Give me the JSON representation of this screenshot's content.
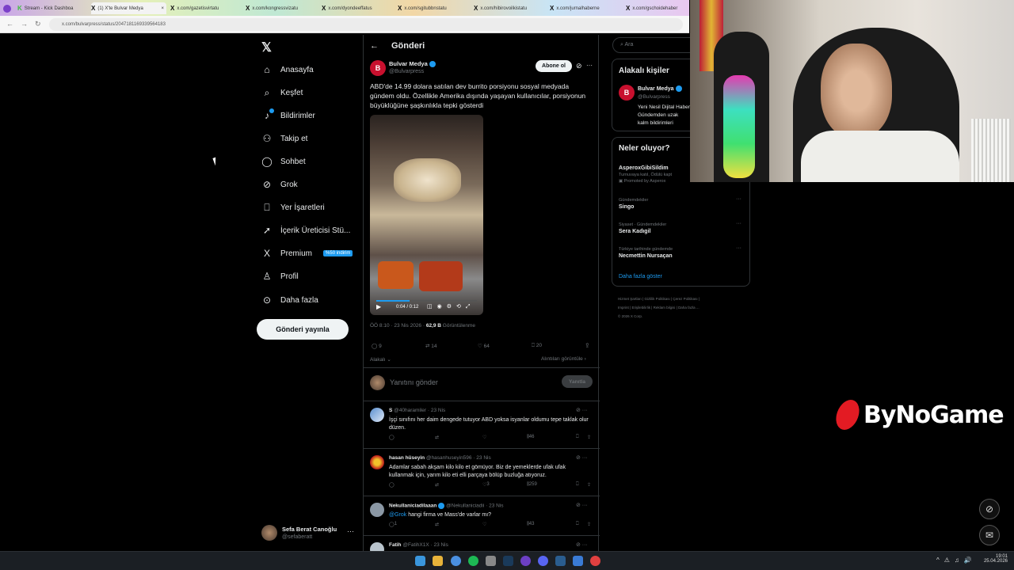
{
  "browser": {
    "tabs": [
      {
        "title": "Stream - Kick Dashboa",
        "icon": "kick-icon"
      },
      {
        "title": "(1) X'te Bulvar Medya",
        "icon": "x-icon",
        "active": true
      },
      {
        "title": "x.com/gazetisvirtatu",
        "icon": "x-icon"
      },
      {
        "title": "x.com/kongressvizatu",
        "icon": "x-icon"
      },
      {
        "title": "x.com/dyondeeffatus",
        "icon": "x-icon"
      },
      {
        "title": "x.com/sgitubbnstatu",
        "icon": "x-icon"
      },
      {
        "title": "x.com/hibirovoilkistatu",
        "icon": "x-icon"
      },
      {
        "title": "x.com/jurnalhaberne",
        "icon": "x-icon"
      },
      {
        "title": "x.com/gschoidehaber",
        "icon": "x-icon"
      }
    ],
    "url": "x.com/bulvarpress/status/2047181169339564183"
  },
  "nav": {
    "items": [
      {
        "label": "Anasayfa",
        "icon": "home-icon"
      },
      {
        "label": "Keşfet",
        "icon": "search-icon"
      },
      {
        "label": "Bildirimler",
        "icon": "bell-icon"
      },
      {
        "label": "Takip et",
        "icon": "follow-icon"
      },
      {
        "label": "Sohbet",
        "icon": "chat-icon"
      },
      {
        "label": "Grok",
        "icon": "grok-icon"
      },
      {
        "label": "Yer İşaretleri",
        "icon": "bookmark-icon"
      },
      {
        "label": "İçerik Üreticisi Stü...",
        "icon": "rocket-icon"
      },
      {
        "label": "Premium",
        "icon": "x-icon"
      },
      {
        "label": "Profil",
        "icon": "person-icon"
      },
      {
        "label": "Daha fazla",
        "icon": "more-circle-icon"
      }
    ],
    "premium_badge": "%50 indirim",
    "post_button": "Gönderi yayınla",
    "account_name": "Sefa Berat Canoğlu",
    "account_handle": "@sefaberatt"
  },
  "post": {
    "header_title": "Gönderi",
    "author_name": "Bulvar Medya",
    "author_handle": "@Bulvarpress",
    "follow_button": "Abone ol",
    "text": "ABD'de 14.99 dolara satılan dev burrito porsiyonu sosyal medyada gündem oldu. Özellikle Amerika dışında yaşayan kullanıcılar, porsiyonun büyüklüğüne şaşkınlıkla tepki gösterdi",
    "video_time": "0:04 / 0:12",
    "video_progress": 0.33,
    "timestamp": "ÖÖ 8:10 · 23 Nis 2026 ·",
    "views": "62,9 B",
    "views_label": "Görüntülenme",
    "replies": "9",
    "reposts": "14",
    "likes": "64",
    "bookmarks": "20",
    "relevant": "Alakalı",
    "quotes": "Alıntıları görüntüle",
    "reply_placeholder": "Yanıtını gönder",
    "reply_button": "Yanıtla"
  },
  "replies": [
    {
      "name": "S",
      "handle": "@40haramiler · 23 Nis",
      "text": "İşçi sınıfını her daim dengede tutuyor ABD yoksa isyanlar oldumu tepe taklak olur düzen.",
      "replies": "",
      "reposts": "",
      "likes": "",
      "views": "46"
    },
    {
      "name": "hasan hüseyin",
      "handle": "@hasanhuseyin596 · 23 Nis",
      "text": "Adamlar sabah akşam kilo kilo et gömüyor. Biz de yemeklerde ufak ufak kullanmak için, yarım kilo eti elli parçaya bölüp buzluğa atıyoruz.",
      "replies": "",
      "reposts": "",
      "likes": "3",
      "views": "259"
    },
    {
      "name": "Nekullaniciadilaaan",
      "handle": "@Nekullaniciadii · 23 Nis",
      "mention": "@Grok",
      "text": " hangi firma ve Mass'de varlar mı?",
      "replies": "1",
      "reposts": "",
      "likes": "",
      "views": "43"
    },
    {
      "name": "Fatih",
      "handle": "@FatihX1X · 23 Nis",
      "text": "",
      "replies": "",
      "reposts": "",
      "likes": "",
      "views": ""
    }
  ],
  "right": {
    "search_placeholder": "Ara",
    "related_title": "Alakalı kişiler",
    "related_name": "Bulvar Medya",
    "related_handle": "@Bulvarpress",
    "related_bio": "Yeni Nesil Dijital Haber Gündemden uzak kalm bildirimleri açabilirsi",
    "trends_title": "Neler oluyor?",
    "trends": [
      {
        "category": "",
        "name": "AsperoxGibiSildim",
        "sub": "Turnuvaya katıl, Ödülü kapt",
        "promo": "Promoted by Asperox"
      },
      {
        "category": "Gündemdekiler",
        "name": "Singo"
      },
      {
        "category": "Siyaset · Gündemdekiler",
        "name": "Sera Kadıgil"
      },
      {
        "category": "Türkiye tarihinde gündemde",
        "name": "Necmettin Nursaçan"
      }
    ],
    "show_more": "Daha fazla göster",
    "footer": [
      "Hizmet Şartları",
      "Gizlilik Politikası",
      "Çerez Politikası",
      "Imprint",
      "Erişilebilirlik",
      "Reklam bilgisi",
      "Daha fazla ...",
      "© 2026 X Corp."
    ]
  },
  "overlay": {
    "brand": "ByNoGame"
  },
  "taskbar": {
    "time": "19:01",
    "date": "25.04.2026"
  },
  "colors": {
    "accent": "#1d9bf0",
    "background": "#000000",
    "border": "#2f3336",
    "muted": "#71767b"
  }
}
